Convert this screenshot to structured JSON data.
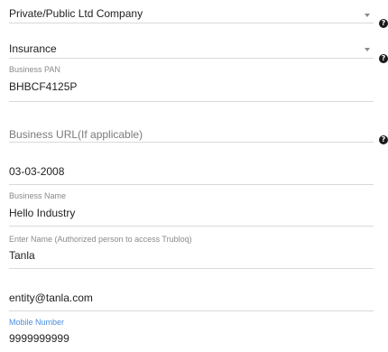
{
  "form": {
    "company_type": {
      "value": "Private/Public Ltd Company",
      "help_icon": "?"
    },
    "industry": {
      "value": "Insurance",
      "help_icon": "?"
    },
    "business_pan": {
      "label": "Business PAN",
      "value": "BHBCF4125P"
    },
    "business_url": {
      "placeholder": "Business URL(If applicable)",
      "help_icon": "?"
    },
    "incorporation_date": {
      "value": "03-03-2008"
    },
    "business_name": {
      "label": "Business Name",
      "value": "Hello Industry"
    },
    "authorized_name": {
      "label": "Enter Name (Authorized person to access Trubloq)",
      "value": "Tanla"
    },
    "email": {
      "value": "entity@tanla.com"
    },
    "mobile_number": {
      "label": "Mobile Number",
      "value": "9999999999"
    }
  },
  "colors": {
    "active_label": "#4a8fe0",
    "label": "#8a8a8a",
    "underline": "#d9d9d9",
    "text": "#222222"
  },
  "icons": [
    "chevron-down-icon",
    "help-icon"
  ]
}
